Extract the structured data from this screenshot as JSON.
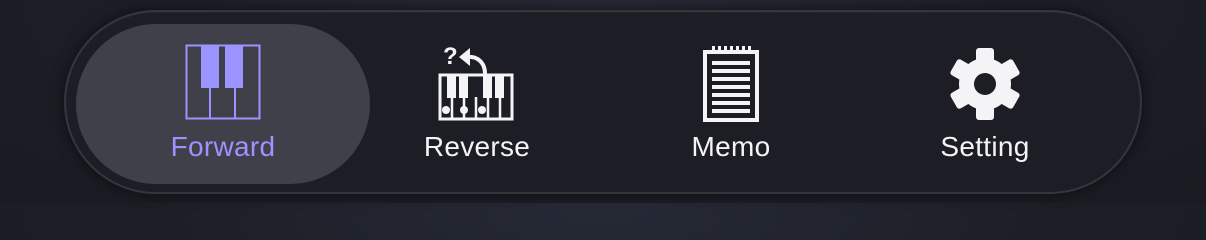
{
  "tab_bar": {
    "active_tab": "Forward",
    "accent_color": "#9b93ff",
    "text_color": "#f4f4f7",
    "tabs": [
      {
        "label": "Forward",
        "icon": "piano-keys-icon",
        "active": true
      },
      {
        "label": "Reverse",
        "icon": "piano-reverse-question-icon",
        "active": false
      },
      {
        "label": "Memo",
        "icon": "notepad-icon",
        "active": false
      },
      {
        "label": "Setting",
        "icon": "gear-icon",
        "active": false
      }
    ],
    "reverse_icon_glyph": "?"
  }
}
